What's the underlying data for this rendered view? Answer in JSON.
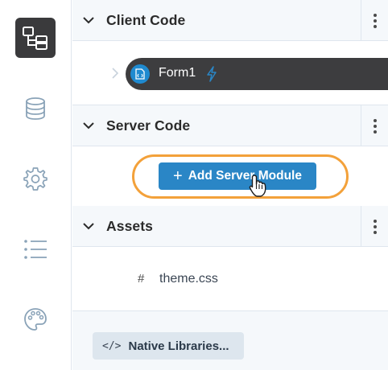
{
  "rail": {
    "items": [
      {
        "name": "app-browser",
        "icon": "folder-tree-icon",
        "active": true
      },
      {
        "name": "data-tables",
        "icon": "database-icon",
        "active": false
      },
      {
        "name": "settings",
        "icon": "gear-icon",
        "active": false
      },
      {
        "name": "outline",
        "icon": "list-icon",
        "active": false
      },
      {
        "name": "theme",
        "icon": "palette-icon",
        "active": false
      }
    ]
  },
  "sections": {
    "client": {
      "title": "Client Code"
    },
    "server": {
      "title": "Server Code"
    },
    "assets": {
      "title": "Assets"
    }
  },
  "client_items": [
    {
      "label": "Form1",
      "icon": "form-icon",
      "startup": "bolt-icon"
    }
  ],
  "server": {
    "add_button_label": "Add Server Module"
  },
  "assets": [
    {
      "prefix": "#",
      "label": "theme.css"
    }
  ],
  "native_libraries": {
    "label": "Native Libraries...",
    "icon": "</>"
  },
  "colors": {
    "accent": "#2a86c6",
    "highlight": "#f3a13a",
    "active_rail": "#3a3a3c",
    "selected_row": "#3d3d3f"
  }
}
